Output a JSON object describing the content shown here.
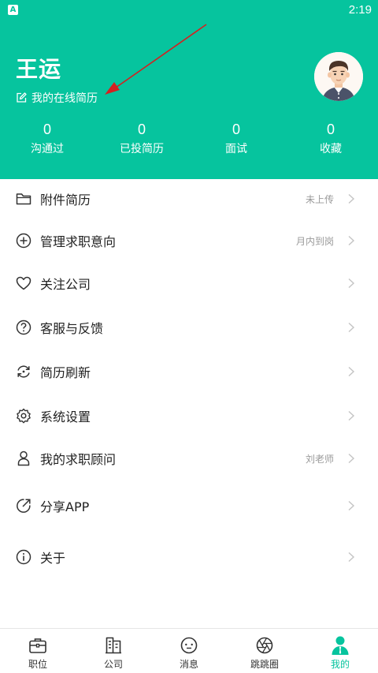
{
  "status_bar": {
    "app_icon_glyph": "A",
    "time": "2:19"
  },
  "profile": {
    "name": "王运",
    "resume_link_label": "我的在线简历",
    "avatar_icon": "avatar-icon"
  },
  "stats": [
    {
      "value": "0",
      "label": "沟通过"
    },
    {
      "value": "0",
      "label": "已投简历"
    },
    {
      "value": "0",
      "label": "面试"
    },
    {
      "value": "0",
      "label": "收藏"
    }
  ],
  "menu": [
    {
      "label": "附件简历",
      "value": "未上传",
      "icon": "folder-icon"
    },
    {
      "label": "管理求职意向",
      "value": "月内到岗",
      "icon": "plus-circle-icon"
    },
    {
      "label": "关注公司",
      "value": "",
      "icon": "heart-icon"
    },
    {
      "label": "客服与反馈",
      "value": "",
      "icon": "help-circle-icon"
    },
    {
      "label": "简历刷新",
      "value": "",
      "icon": "refresh-icon"
    },
    {
      "label": "系统设置",
      "value": "",
      "icon": "settings-icon"
    },
    {
      "label": "我的求职顾问",
      "value": "刘老师",
      "icon": "person-icon"
    },
    {
      "label": "分享APP",
      "value": "",
      "icon": "share-icon"
    },
    {
      "label": "关于",
      "value": "",
      "icon": "info-icon"
    }
  ],
  "tabs": [
    {
      "label": "职位",
      "icon": "briefcase-icon",
      "active": false
    },
    {
      "label": "公司",
      "icon": "building-icon",
      "active": false
    },
    {
      "label": "消息",
      "icon": "message-icon",
      "active": false
    },
    {
      "label": "跳跳圈",
      "icon": "aperture-icon",
      "active": false
    },
    {
      "label": "我的",
      "icon": "user-icon",
      "active": true
    }
  ],
  "colors": {
    "primary": "#06c49e",
    "annotation_arrow": "#d42020"
  }
}
